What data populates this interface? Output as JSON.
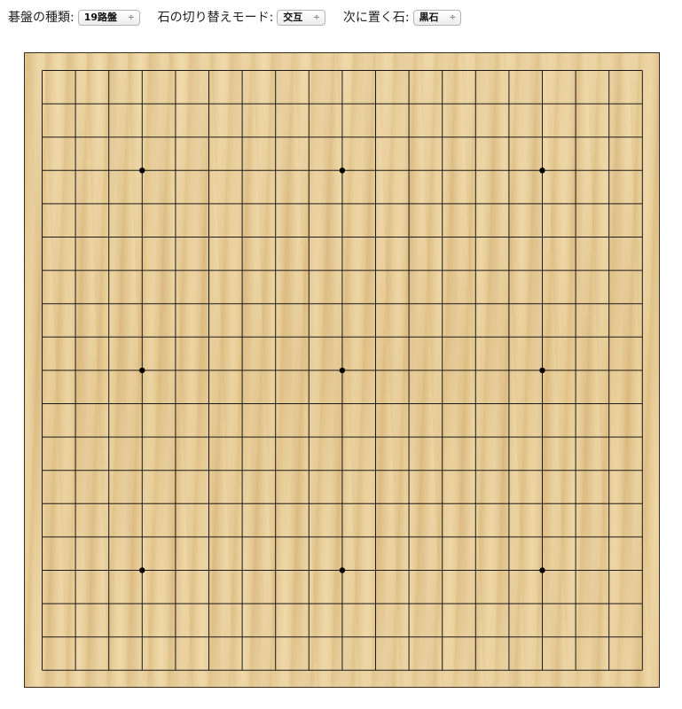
{
  "toolbar": {
    "board_type": {
      "label": "碁盤の種類:",
      "value": "19路盤",
      "arrow": "÷"
    },
    "switch_mode": {
      "label": "石の切り替えモード:",
      "value": "交互",
      "arrow": "÷"
    },
    "next_stone": {
      "label": "次に置く石:",
      "value": "黒石",
      "arrow": "÷"
    }
  },
  "board": {
    "size": 19,
    "star_points": [
      [
        3,
        3
      ],
      [
        9,
        3
      ],
      [
        15,
        3
      ],
      [
        3,
        9
      ],
      [
        9,
        9
      ],
      [
        15,
        9
      ],
      [
        3,
        15
      ],
      [
        9,
        15
      ],
      [
        15,
        15
      ]
    ],
    "line_color": "#1a1a1a",
    "star_color": "#000000",
    "wood_color": "#ead3a0"
  }
}
